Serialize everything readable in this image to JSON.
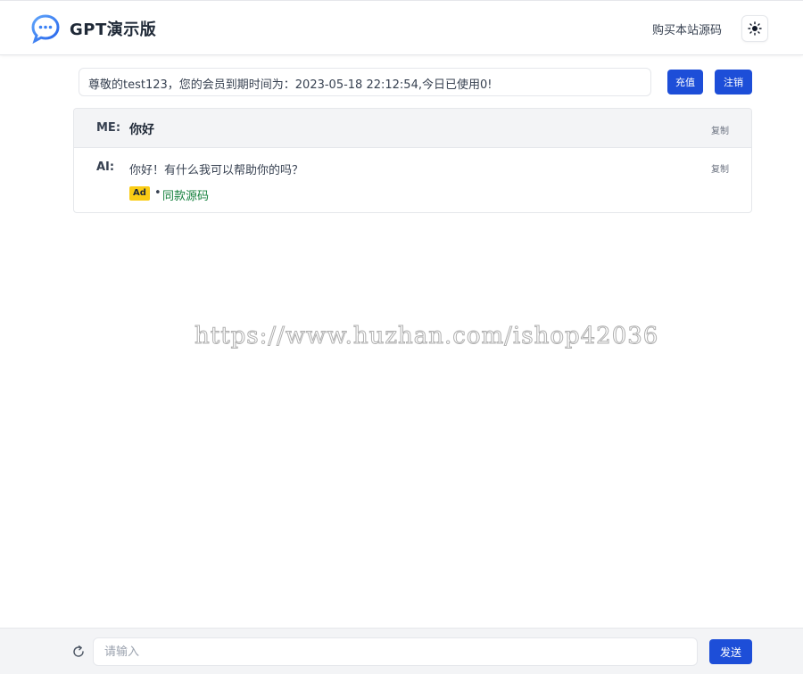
{
  "header": {
    "title": "GPT演示版",
    "buy_source_link": "购买本站源码",
    "theme_icon": "sun-icon",
    "logo_icon": "chat-bubble-icon"
  },
  "info": {
    "text": "尊敬的test123，您的会员到期时间为：2023-05-18 22:12:54,今日已使用0!",
    "recharge_label": "充值",
    "logout_label": "注销"
  },
  "chat": {
    "messages": [
      {
        "role": "ME:",
        "text": "你好",
        "copy_label": "复制"
      },
      {
        "role": "AI:",
        "text": "你好！有什么我可以帮助你的吗？",
        "copy_label": "复制"
      }
    ],
    "ad": {
      "badge": "Ad",
      "bullet": "•",
      "link_text": "同款源码"
    }
  },
  "watermark": "https://www.huzhan.com/ishop42036",
  "footer": {
    "input_placeholder": "请输入",
    "send_label": "发送",
    "refresh_icon": "refresh-icon"
  },
  "colors": {
    "primary": "#1d4ed8",
    "ad_badge": "#facc15",
    "ad_link": "#15803d",
    "logo": "#3b82f6"
  }
}
